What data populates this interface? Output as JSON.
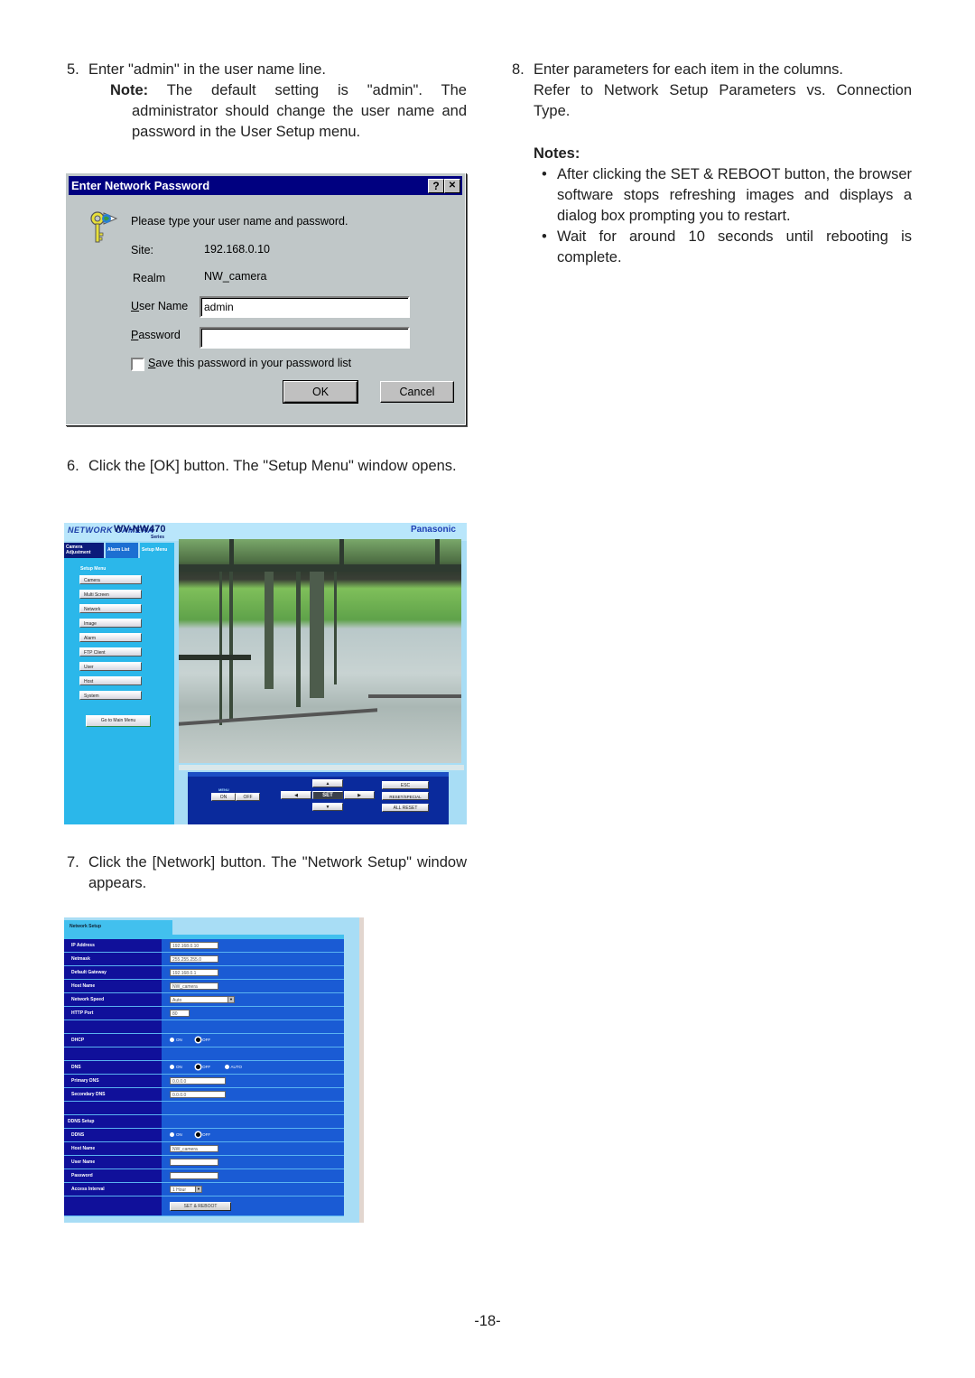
{
  "step5": {
    "num": "5.",
    "text": "Enter \"admin\" in the user name line.",
    "note_label": "Note:",
    "note_text": " The default setting is \"admin\". The administrator should change the user name and password in the User Setup menu."
  },
  "password_dialog": {
    "title": "Enter Network Password",
    "help_button": "?",
    "close_button": "✕",
    "prompt": "Please type your user name and password.",
    "site_label": "Site:",
    "site_value": "192.168.0.10",
    "realm_label": "Realm",
    "realm_value": "NW_camera",
    "username_label_accel": "U",
    "username_label_rest": "ser Name",
    "username_value": "admin",
    "password_label_accel": "P",
    "password_label_rest": "assword",
    "password_value": "",
    "save_checkbox_accel": "S",
    "save_checkbox_rest": "ave this password in your password list",
    "save_checked": false,
    "ok_label": "OK",
    "cancel_label": "Cancel"
  },
  "step6": {
    "num": "6.",
    "text": "Click the [OK] button. The \"Setup Menu\" window opens."
  },
  "setup_menu": {
    "logo": "NETWORK CAMERA",
    "model": "WV-NW470",
    "series": "Series",
    "brand": "Panasonic",
    "tabs": [
      "Camera Adjustment",
      "Alarm List",
      "Setup Menu"
    ],
    "menu_title": "Setup Menu",
    "menu_items": [
      "Camera",
      "Multi Screen",
      "Network",
      "Image",
      "Alarm",
      "FTP Client",
      "User",
      "Host",
      "System"
    ],
    "go_main": "Go to Main Menu",
    "controls": {
      "menu_label": "MENU",
      "on": "ON",
      "off": "OFF",
      "up": "▲",
      "down": "▼",
      "left": "◀",
      "right": "▶",
      "set": "SET",
      "esc": "ESC",
      "reset_special": "RESET/SPECIAL",
      "all_reset": "ALL RESET"
    }
  },
  "step7": {
    "num": "7.",
    "text": "Click the [Network] button. The \"Network Setup\" window appears."
  },
  "network_setup": {
    "tab": "Network Setup",
    "ip_address_label": "IP Address",
    "ip_address": "192.168.0.10",
    "netmask_label": "Netmask",
    "netmask": "255.255.255.0",
    "gateway_label": "Default Gateway",
    "gateway": "192.168.0.1",
    "host_name_label": "Host Name",
    "host_name": "NW_camera",
    "speed_label": "Network Speed",
    "speed": "Auto",
    "http_port_label": "HTTP Port",
    "http_port": "80",
    "dhcp_label": "DHCP",
    "dhcp_on": "ON",
    "dhcp_off": "OFF",
    "dhcp_selected": "OFF",
    "dns_label": "DNS",
    "dns_on": "ON",
    "dns_off": "OFF",
    "dns_auto": "AUTO",
    "dns_selected": "OFF",
    "primary_dns_label": "Primary DNS",
    "primary_dns": "0.0.0.0",
    "secondary_dns_label": "Secondary DNS",
    "secondary_dns": "0.0.0.0",
    "ddns_setup_label": "DDNS Setup",
    "ddns_label": "DDNS",
    "ddns_on": "ON",
    "ddns_off": "OFF",
    "ddns_selected": "OFF",
    "ddns_host_label": "Host Name",
    "ddns_host": "NW_camera",
    "ddns_user_label": "User Name",
    "ddns_user": "",
    "ddns_password_label": "Password",
    "ddns_password": "",
    "interval_label": "Access Interval",
    "interval": "1 Hour",
    "set_reboot": "SET & REBOOT"
  },
  "step8": {
    "num": "8.",
    "text": "Enter parameters for each item in the columns.",
    "text2": "Refer to Network Setup Parameters vs. Connection Type.",
    "notes_title": "Notes:",
    "notes": [
      "After clicking the SET & REBOOT button, the browser software stops refreshing images and displays a dialog box prompting you to restart.",
      "Wait for around 10 seconds until rebooting is complete."
    ]
  },
  "page_number": "-18-"
}
